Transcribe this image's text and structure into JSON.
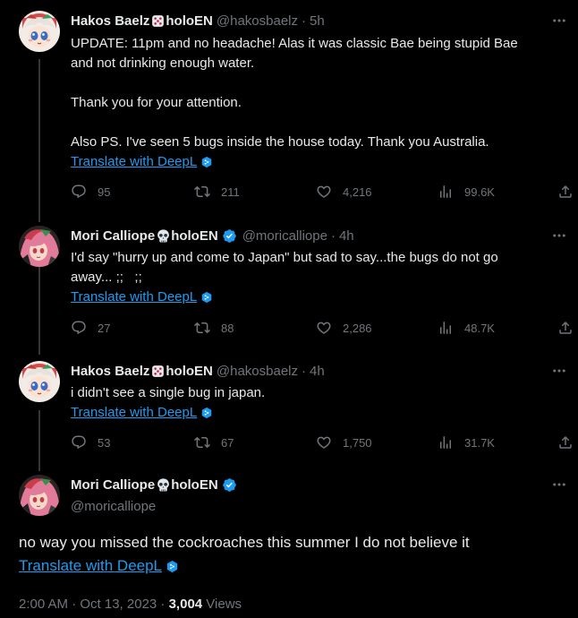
{
  "tweets": [
    {
      "name": "Hakos Baelz",
      "affil": "holoEN",
      "handle": "@hakosbaelz",
      "time": "5h",
      "lines": [
        "UPDATE: 11pm and no headache! Alas it was classic Bae being stupid Bae",
        "and not drinking enough water.",
        "",
        "Thank you for your attention.",
        "",
        "Also PS. I've seen 5 bugs inside the house today. Thank you Australia."
      ],
      "translate": "Translate with DeepL",
      "replies": "95",
      "retweets": "211",
      "likes": "4,216",
      "views": "99.6K"
    },
    {
      "name": "Mori Calliope",
      "affil": "holoEN",
      "handle": "@moricalliope",
      "time": "4h",
      "lines": [
        "I'd say \"hurry up and come to Japan\" but sad to say...the bugs do not go",
        "away... ;;   ;;"
      ],
      "translate": "Translate with DeepL",
      "replies": "27",
      "retweets": "88",
      "likes": "2,286",
      "views": "48.7K"
    },
    {
      "name": "Hakos Baelz",
      "affil": "holoEN",
      "handle": "@hakosbaelz",
      "time": "4h",
      "lines": [
        "i didn't see a single bug in japan."
      ],
      "translate": "Translate with DeepL",
      "replies": "53",
      "retweets": "67",
      "likes": "1,750",
      "views": "31.7K"
    }
  ],
  "main": {
    "name": "Mori Calliope",
    "affil": "holoEN",
    "handle": "@moricalliope",
    "text": "no way you missed the cockroaches this summer I do not believe it",
    "translate": "Translate with DeepL",
    "timestamp": "2:00 AM · Oct 13, 2023 · ",
    "views_count": "3,004",
    "views_label": " Views"
  },
  "colors": {
    "background": "#000000",
    "text": "#e7e9ea",
    "muted": "#71767b",
    "link": "#1d9bf0",
    "verified": "#1d9bf0"
  },
  "icons": {
    "die": "die-emoji-icon",
    "skull": "skull-emoji-icon",
    "verified": "verified-badge-icon",
    "more": "more-icon",
    "reply": "reply-icon",
    "retweet": "retweet-icon",
    "like": "heart-icon",
    "views": "views-icon",
    "share": "share-icon",
    "deepl": "deepl-icon"
  }
}
